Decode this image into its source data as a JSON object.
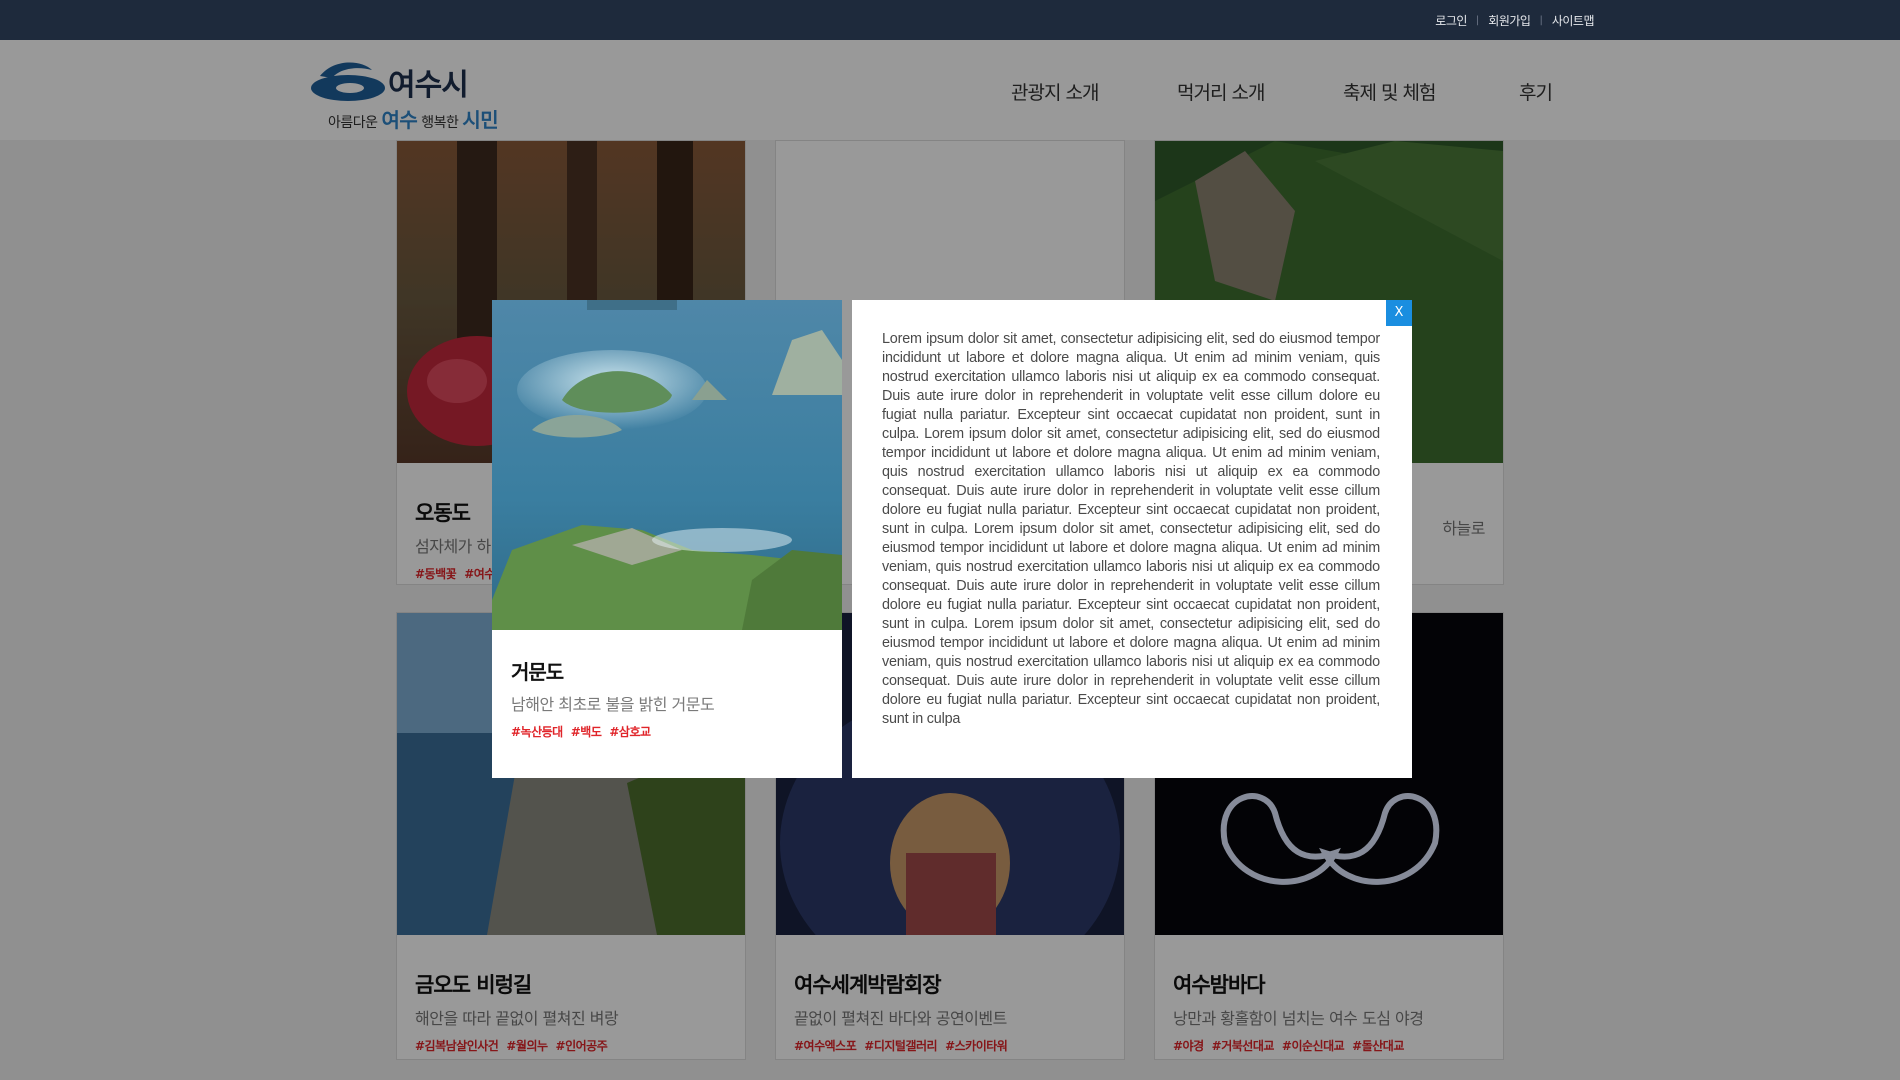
{
  "util_nav": {
    "login": "로그인",
    "join": "회원가입",
    "sitemap": "사이트맵"
  },
  "logo": {
    "city": "여수시",
    "slogan_a": "아름다운 ",
    "slogan_b": "여수",
    "slogan_c": " 행복한 ",
    "slogan_d": "시민"
  },
  "gnb": [
    "관광지 소개",
    "먹거리 소개",
    "축제 및 체험",
    "후기"
  ],
  "cards": [
    {
      "title": "오동도",
      "sub": "섬자체가 하",
      "tags": [
        "#동백꽃",
        "#여수"
      ]
    },
    {
      "title": "",
      "sub": "",
      "tags": []
    },
    {
      "title": "",
      "sub": "하늘로",
      "tags": []
    },
    {
      "title": "금오도 비렁길",
      "sub": "해안을 따라 끝없이 펼쳐진 벼랑",
      "tags": [
        "#김복남살인사건",
        "#월의누",
        "#인어공주"
      ]
    },
    {
      "title": "여수세계박람회장",
      "sub": "끝없이 펼쳐진 바다와 공연이벤트",
      "tags": [
        "#여수엑스포",
        "#디지털갤러리",
        "#스카이타워"
      ]
    },
    {
      "title": "여수밤바다",
      "sub": "낭만과 황홀함이 넘치는 여수 도심 야경",
      "tags": [
        "#야경",
        "#거북선대교",
        "#이순신대교",
        "#돌산대교"
      ]
    }
  ],
  "modal": {
    "title": "거문도",
    "sub": "남해안 최초로 불을 밝힌 거문도",
    "tags": [
      "#녹산등대",
      "#백도",
      "#삼호교"
    ],
    "close": "X",
    "text": "Lorem ipsum dolor sit amet, consectetur adipisicing elit, sed do eiusmod tempor incididunt ut labore et dolore magna aliqua. Ut enim ad minim veniam, quis nostrud exercitation ullamco laboris nisi ut aliquip ex ea commodo consequat. Duis aute irure dolor in reprehenderit in voluptate velit esse cillum dolore eu fugiat nulla pariatur. Excepteur sint occaecat cupidatat non proident, sunt in culpa. Lorem ipsum dolor sit amet, consectetur adipisicing elit, sed do eiusmod tempor incididunt ut labore et dolore magna aliqua. Ut enim ad minim veniam, quis nostrud exercitation ullamco laboris nisi ut aliquip ex ea commodo consequat. Duis aute irure dolor in reprehenderit in voluptate velit esse cillum dolore eu fugiat nulla pariatur. Excepteur sint occaecat cupidatat non proident, sunt in culpa. Lorem ipsum dolor sit amet, consectetur adipisicing elit, sed do eiusmod tempor incididunt ut labore et dolore magna aliqua. Ut enim ad minim veniam, quis nostrud exercitation ullamco laboris nisi ut aliquip ex ea commodo consequat. Duis aute irure dolor in reprehenderit in voluptate velit esse cillum dolore eu fugiat nulla pariatur. Excepteur sint occaecat cupidatat non proident, sunt in culpa. Lorem ipsum dolor sit amet, consectetur adipisicing elit, sed do eiusmod tempor incididunt ut labore et dolore magna aliqua. Ut enim ad minim veniam, quis nostrud exercitation ullamco laboris nisi ut aliquip ex ea commodo consequat. Duis aute irure dolor in reprehenderit in voluptate velit esse cillum dolore eu fugiat nulla pariatur. Excepteur sint occaecat cupidatat non proident, sunt in culpa"
  },
  "colors": {
    "topbar": "#1e2a3c",
    "accent": "#1a8ee0",
    "tag": "#e0252a"
  }
}
